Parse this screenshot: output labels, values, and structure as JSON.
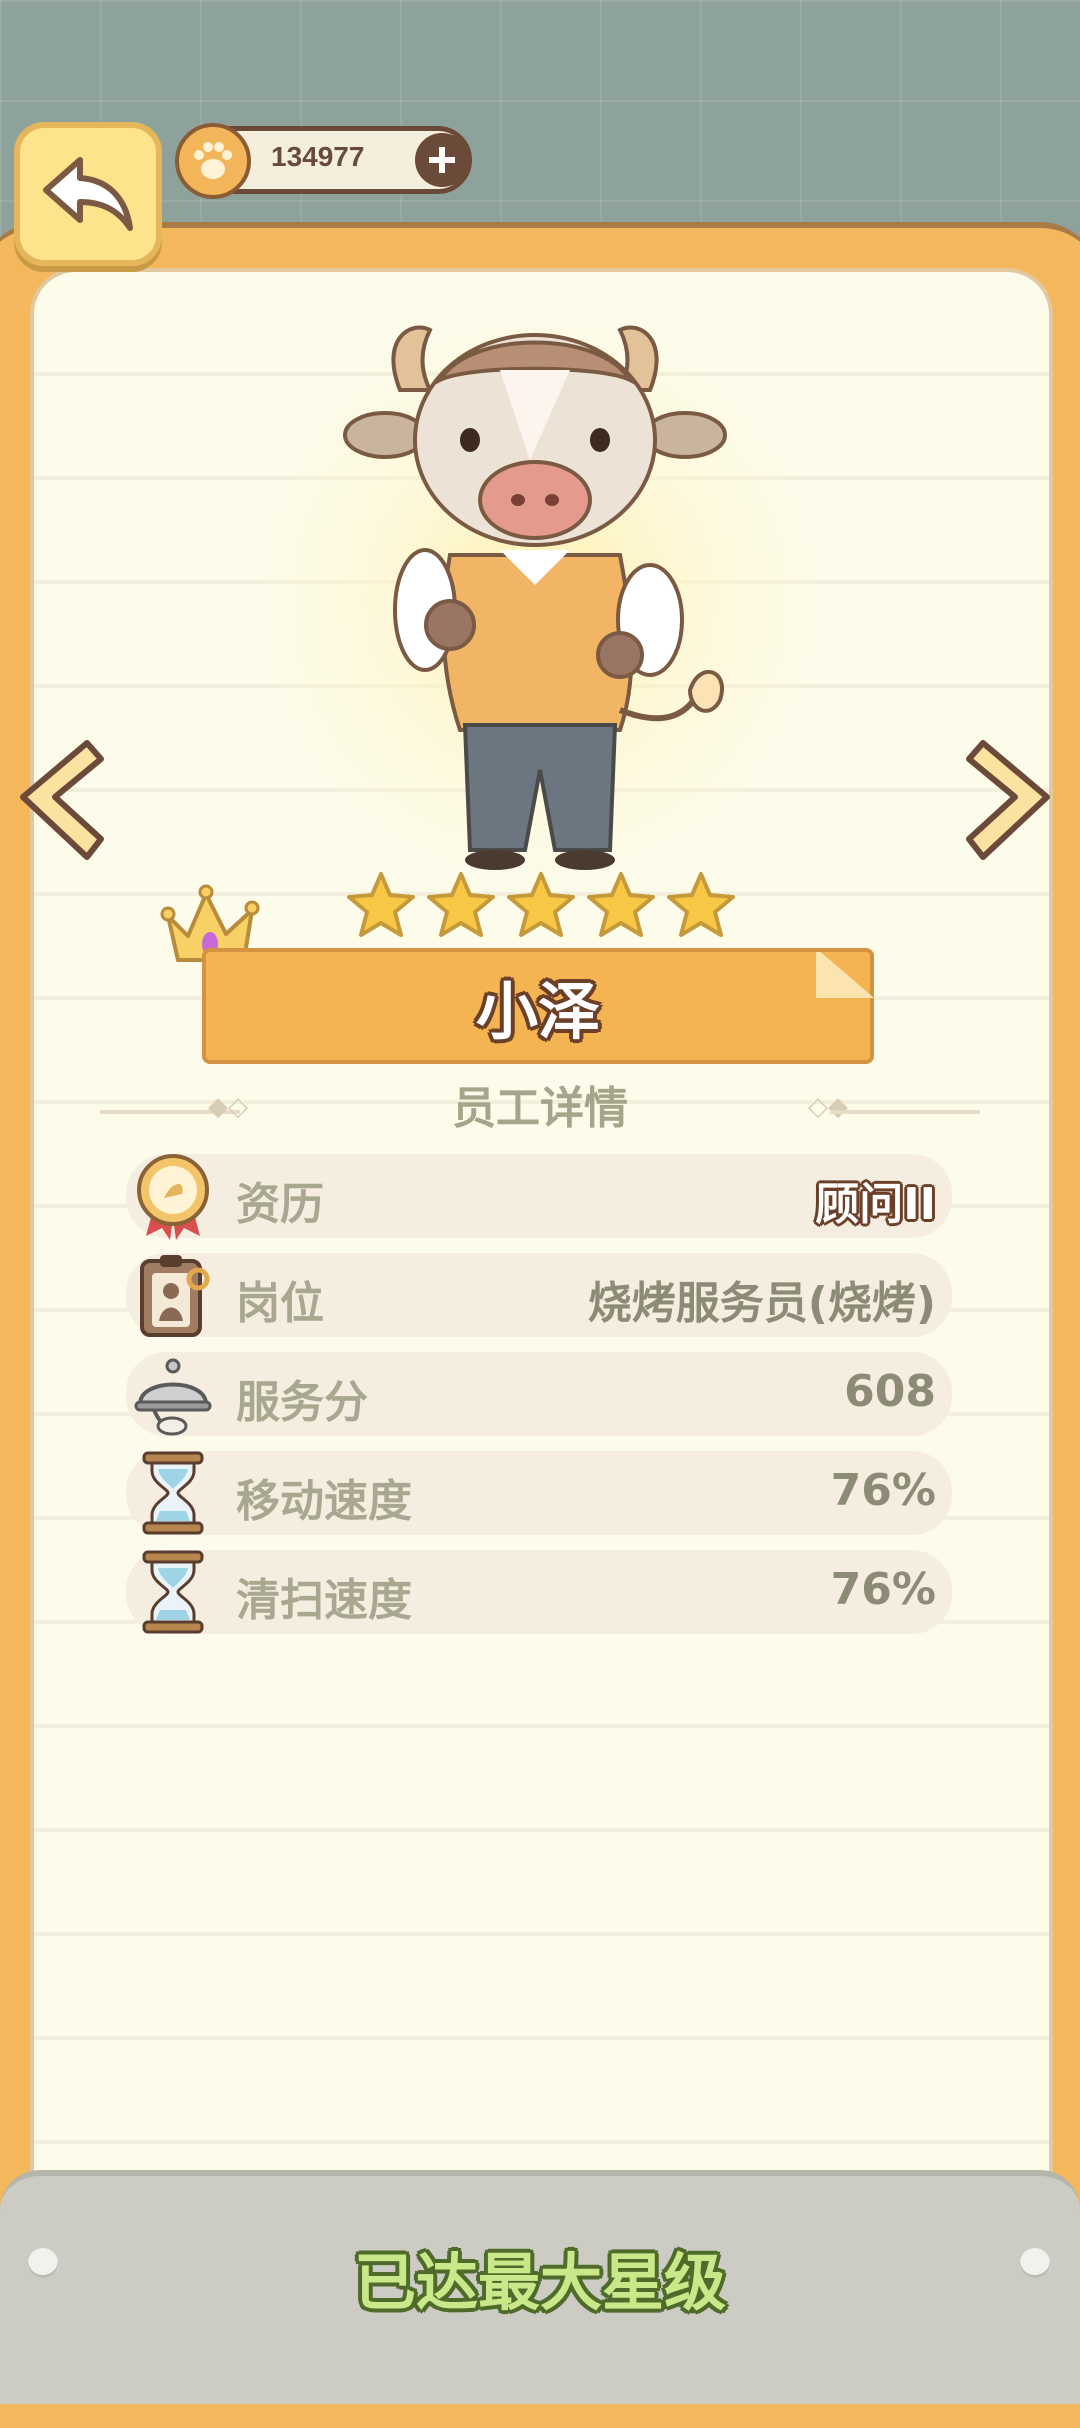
{
  "header": {
    "currency_value": "134977"
  },
  "character": {
    "name": "小泽",
    "stars_filled": 5,
    "stars_total": 5
  },
  "section_title": "员工详情",
  "stats": [
    {
      "label": "资历",
      "value": "顾问II",
      "icon": "medal-icon"
    },
    {
      "label": "岗位",
      "value": "烧烤服务员(烧烤)",
      "icon": "clipboard-icon"
    },
    {
      "label": "服务分",
      "value": "608",
      "icon": "cloche-icon"
    },
    {
      "label": "移动速度",
      "value": "76%",
      "icon": "hourglass-icon"
    },
    {
      "label": "清扫速度",
      "value": "76%",
      "icon": "hourglass-icon"
    }
  ],
  "bottom": {
    "status_text": "已达最大星级"
  },
  "colors": {
    "frame": "#f4b75c",
    "card": "#fdfbea",
    "star": "#f7c746",
    "bottom_text": "#c9e88a"
  }
}
